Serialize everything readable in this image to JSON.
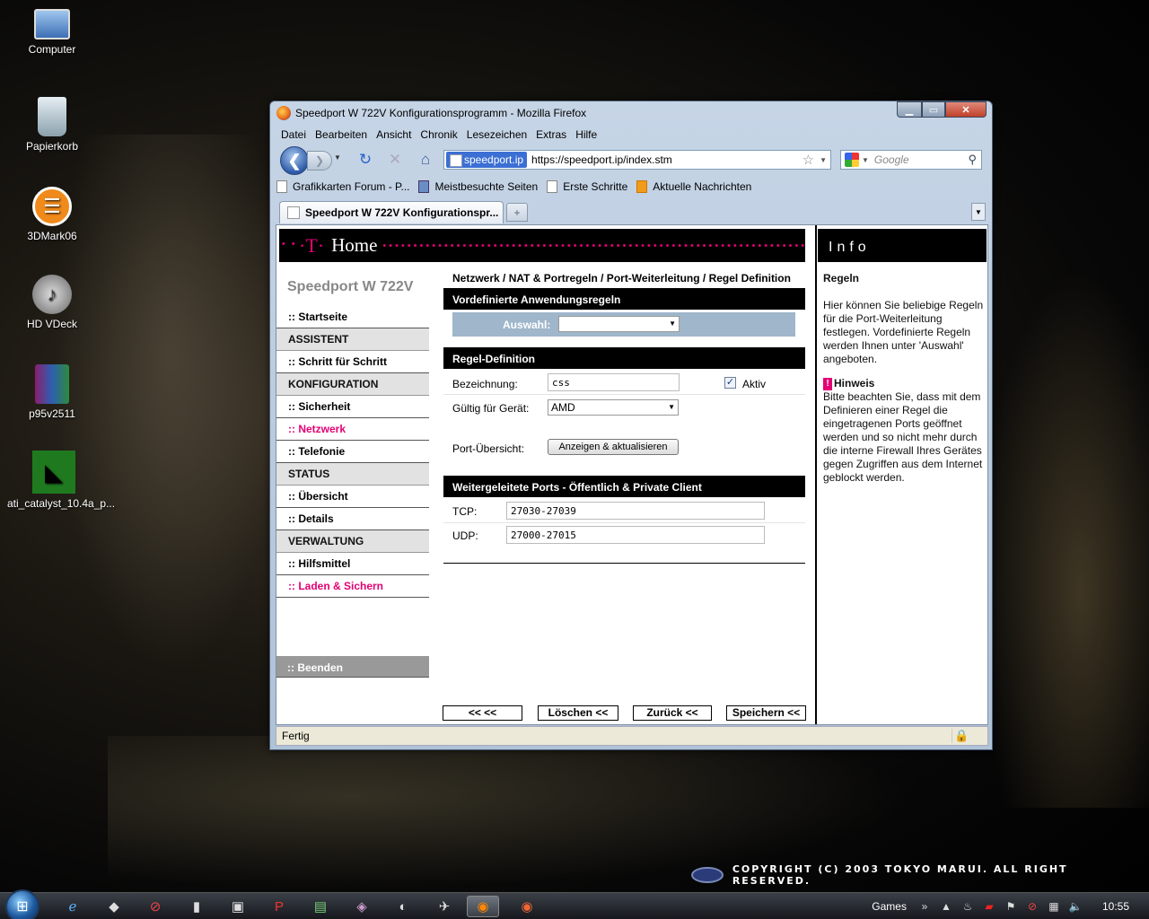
{
  "desktop": {
    "icons": [
      {
        "label": "Computer"
      },
      {
        "label": "Papierkorb"
      },
      {
        "label": "3DMark06"
      },
      {
        "label": "HD VDeck"
      },
      {
        "label": "p95v2511"
      },
      {
        "label": "ati_catalyst_10.4a_p..."
      }
    ],
    "copyright": "COPYRIGHT (C) 2003  TOKYO MARUI.  ALL RIGHT RESERVED."
  },
  "browser": {
    "title": "Speedport W 722V Konfigurationsprogramm - Mozilla Firefox",
    "menu": [
      "Datei",
      "Bearbeiten",
      "Ansicht",
      "Chronik",
      "Lesezeichen",
      "Extras",
      "Hilfe"
    ],
    "url_site": "speedport.ip",
    "url": "https://speedport.ip/index.stm",
    "search_placeholder": "Google",
    "bookmarks": [
      {
        "label": "Grafikkarten Forum - P...",
        "icon": "page-icon"
      },
      {
        "label": "Meistbesuchte Seiten",
        "icon": "most-visited-icon"
      },
      {
        "label": "Erste Schritte",
        "icon": "page-icon"
      },
      {
        "label": "Aktuelle Nachrichten",
        "icon": "rss-icon"
      }
    ],
    "tab_label": "Speedport W 722V Konfigurationspr...",
    "status": "Fertig"
  },
  "page": {
    "brand": "Home",
    "device": "Speedport W 722V",
    "menu": [
      {
        "label": ":: Startseite",
        "type": "item"
      },
      {
        "label": "ASSISTENT",
        "type": "section"
      },
      {
        "label": ":: Schritt für Schritt",
        "type": "item"
      },
      {
        "label": "KONFIGURATION",
        "type": "section"
      },
      {
        "label": ":: Sicherheit",
        "type": "item"
      },
      {
        "label": ":: Netzwerk",
        "type": "active"
      },
      {
        "label": ":: Telefonie",
        "type": "item"
      },
      {
        "label": "STATUS",
        "type": "section"
      },
      {
        "label": ":: Übersicht",
        "type": "item"
      },
      {
        "label": ":: Details",
        "type": "item"
      },
      {
        "label": "VERWALTUNG",
        "type": "section"
      },
      {
        "label": ":: Hilfsmittel",
        "type": "item"
      },
      {
        "label": ":: Laden & Sichern",
        "type": "active"
      }
    ],
    "beenden": ":: Beenden",
    "breadcrumb": "Netzwerk / NAT & Portregeln / Port-Weiterleitung / Regel Definition",
    "section_predefined": "Vordefinierte Anwendungsregeln",
    "auswahl_label": "Auswahl:",
    "auswahl_value": "",
    "section_rule": "Regel-Definition",
    "bezeichnung_label": "Bezeichnung:",
    "bezeichnung_value": "css",
    "aktiv_label": "Aktiv",
    "aktiv_checked": true,
    "geraet_label": "Gültig für Gerät:",
    "geraet_value": "AMD",
    "portuebersicht_label": "Port-Übersicht:",
    "anzeigen_button": "Anzeigen & aktualisieren",
    "section_ports": "Weitergeleitete Ports - Öffentlich & Private Client",
    "tcp_label": "TCP:",
    "tcp_value": "27030-27039",
    "udp_label": "UDP:",
    "udp_value": "27000-27015",
    "buttons": {
      "first": "<<  <<",
      "delete": "Löschen <<",
      "back": "Zurück <<",
      "save": "Speichern <<"
    },
    "info": {
      "header": "Info",
      "title": "Regeln",
      "text": "Hier können Sie beliebige Regeln für die Port-Weiterleitung festlegen. Vordefinierte Regeln werden Ihnen unter 'Auswahl' angeboten.",
      "hinweis_mark": "!",
      "hinweis_title": "Hinweis",
      "hinweis_text": "Bitte beachten Sie, dass mit dem Definieren einer Regel die eingetragenen Ports geöffnet werden und so nicht mehr durch die interne Firewall Ihres Gerätes gegen Zugriffen aus dem Internet geblockt werden."
    }
  },
  "taskbar": {
    "tray_label": "Games",
    "clock": "10:55"
  }
}
